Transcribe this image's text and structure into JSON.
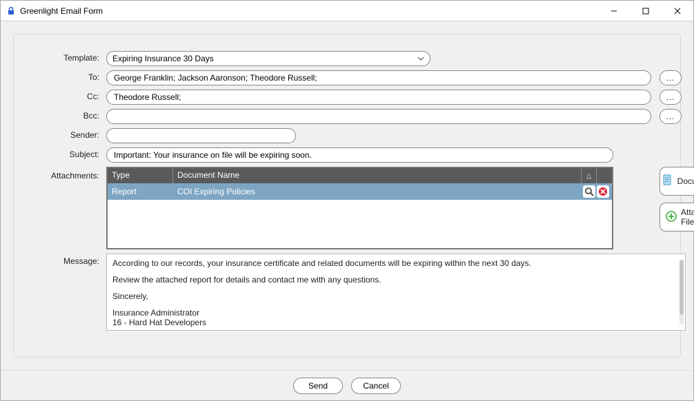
{
  "window": {
    "title": "Greenlight Email Form"
  },
  "labels": {
    "template": "Template:",
    "to": "To:",
    "cc": "Cc:",
    "bcc": "Bcc:",
    "sender": "Sender:",
    "subject": "Subject:",
    "attachments": "Attachments:",
    "message": "Message:"
  },
  "fields": {
    "template": "Expiring Insurance 30 Days",
    "to": "George Franklin; Jackson Aaronson; Theodore Russell;",
    "cc": "Theodore Russell;",
    "bcc": "",
    "sender": "",
    "subject": "Important: Your insurance on file will be expiring soon."
  },
  "attachments": {
    "headers": {
      "type": "Type",
      "name": "Document Name"
    },
    "rows": [
      {
        "type": "Report",
        "name": "COI Expiring Policies"
      }
    ]
  },
  "buttons": {
    "documents": "Documents",
    "attach_file": "Attach File",
    "send": "Send",
    "cancel": "Cancel",
    "dots": "..."
  },
  "message": {
    "line1": "According to our records, your insurance certificate and related documents will be expiring within the next 30 days.",
    "line2": "Review the attached report for details and contact me with any questions.",
    "line3": "Sincerely,",
    "line4": "Insurance Administrator",
    "line5": "16 - Hard Hat Developers"
  }
}
